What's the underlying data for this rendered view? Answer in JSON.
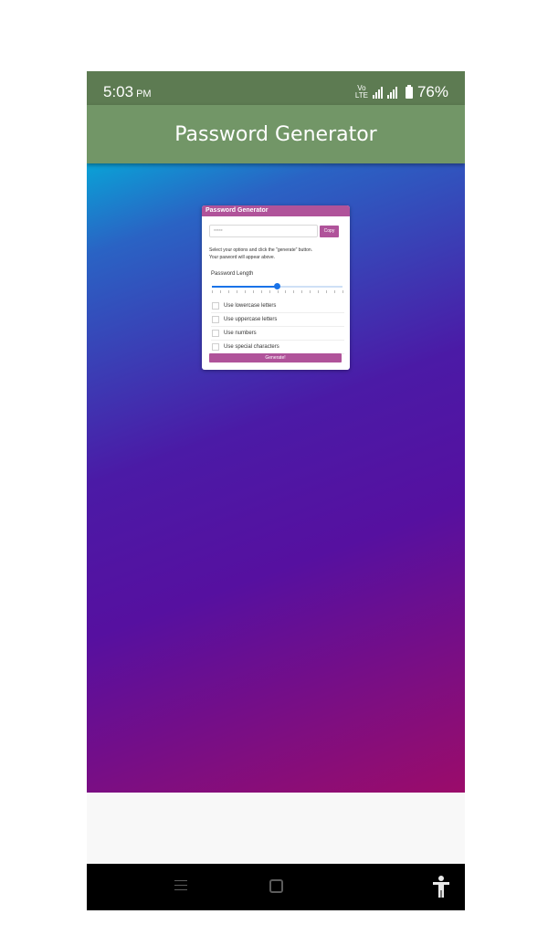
{
  "status_bar": {
    "time": "5:03",
    "ampm": "PM",
    "battery": "76%",
    "network_label_top": "Vo",
    "network_label_bottom": "LTE"
  },
  "app_bar": {
    "title": "Password Generator"
  },
  "card": {
    "header": "Password Generator",
    "password_value": "*****",
    "copy_label": "Copy",
    "instructions_line1": "Select your options and click the \"generate\" button.",
    "instructions_line2": "Your pasword will appear above.",
    "length_label": "Password Length",
    "length_fraction": 0.5,
    "options": [
      {
        "label": "Use lowercase letters",
        "checked": false
      },
      {
        "label": "Use uppercase letters",
        "checked": false
      },
      {
        "label": "Use numbers",
        "checked": false
      },
      {
        "label": "Use special characters",
        "checked": false
      }
    ],
    "generate_label": "Generate!"
  },
  "icons": [
    "menu-icon",
    "home-icon",
    "back-icon",
    "accessibility-icon"
  ],
  "colors": {
    "status_bar": "#5d7b52",
    "app_bar": "#729667",
    "accent": "#b0539a",
    "slider": "#1a73e8"
  }
}
